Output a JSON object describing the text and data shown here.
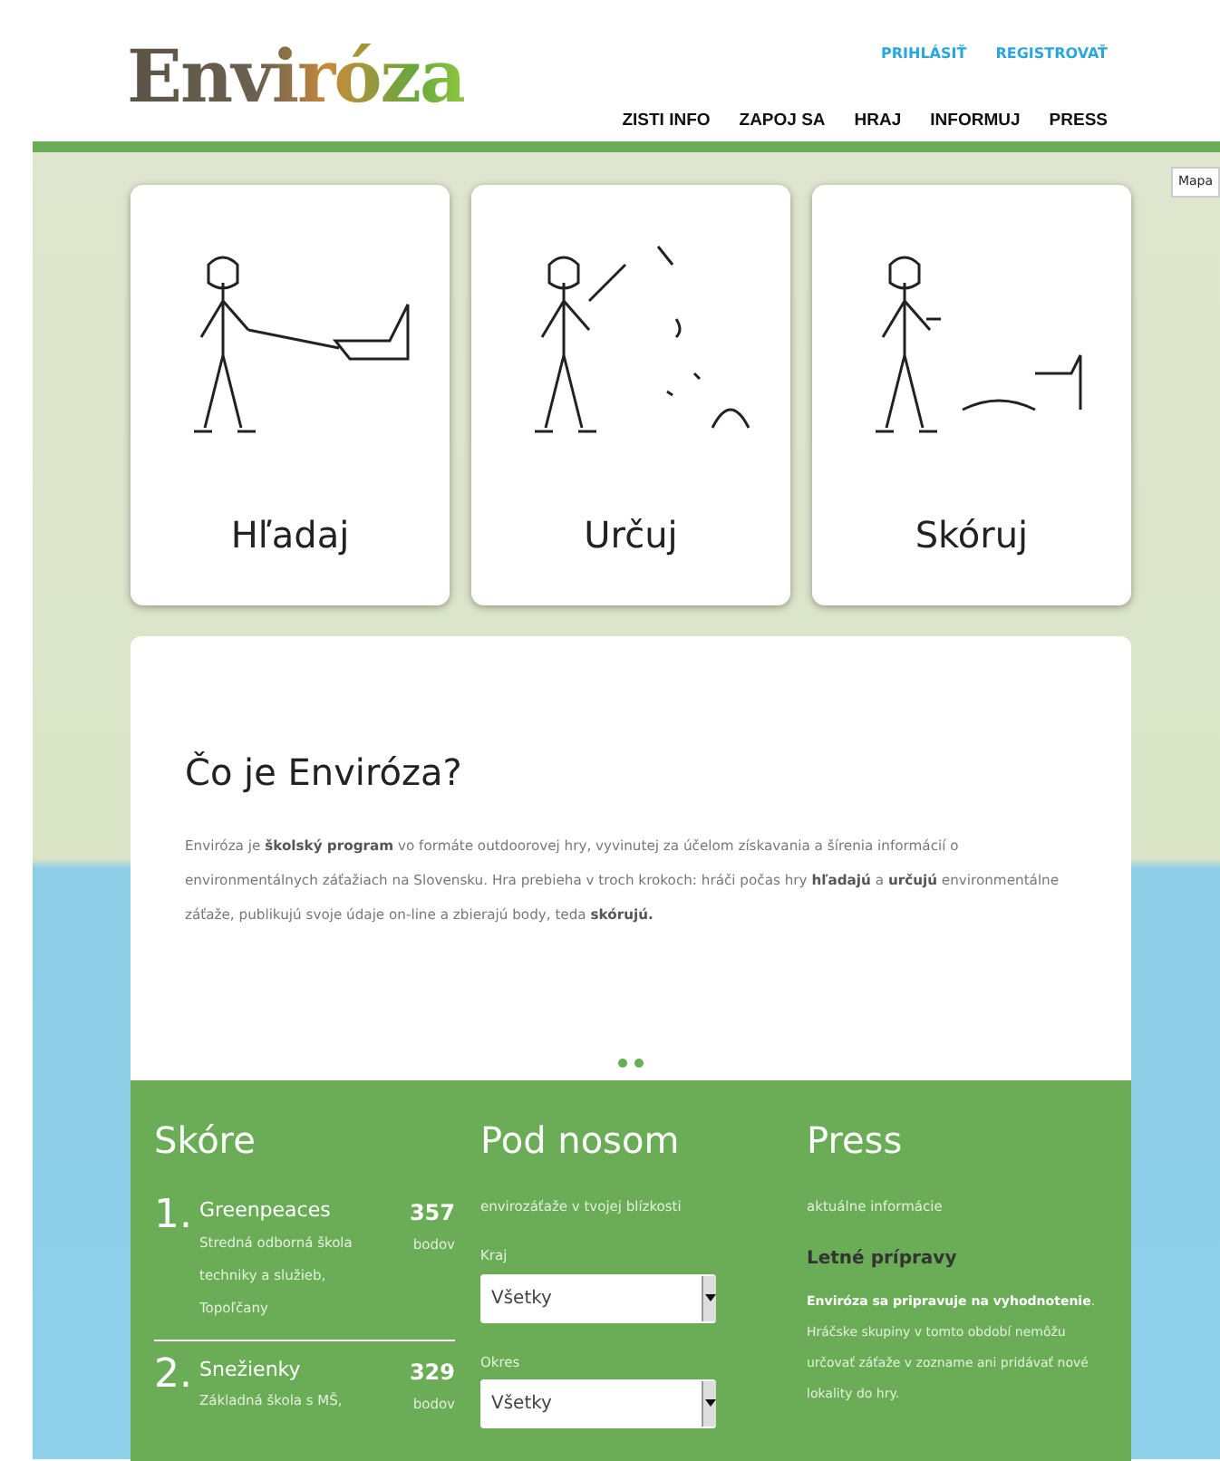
{
  "header": {
    "logo": "Enviróza",
    "account_links": [
      "PRIHLÁSIŤ",
      "REGISTROVAŤ"
    ],
    "nav": [
      "ZISTI INFO",
      "ZAPOJ SA",
      "HRAJ",
      "INFORMUJ",
      "PRESS"
    ]
  },
  "map": {
    "control": "Mapa"
  },
  "steps": [
    {
      "label": "Hľadaj",
      "kind": "search"
    },
    {
      "label": "Určuj",
      "kind": "identify"
    },
    {
      "label": "Skóruj",
      "kind": "score"
    }
  ],
  "intro": {
    "title": "Čo je Enviróza?",
    "text": "Enviróza je **školský program** vo formáte outdoorovej hry, vyvinutej za účelom získavania a šírenia informácií o environmentálnych záťažiach na Slovensku. Hra prebieha v troch krokoch: hráči počas hry **hľadajú** a **určujú** environmentálne záťaže, publikujú svoje údaje on-line a zbierajú body, teda **skórujú.**"
  },
  "score": {
    "title": "Skóre",
    "entries": [
      {
        "rank": "1.",
        "team": "Greenpeaces",
        "school": "Stredná odborná škola techniky a služieb, Topoľčany",
        "points": "357",
        "unit": "bodov"
      },
      {
        "rank": "2.",
        "team": "Snežienky",
        "school": "Základná škola s MŠ,",
        "points": "329",
        "unit": "bodov"
      }
    ]
  },
  "nearby": {
    "title": "Pod nosom",
    "subtitle": "envirozáťaže v tvojej blízkosti",
    "filters": [
      {
        "label": "Kraj",
        "value": "Všetky"
      },
      {
        "label": "Okres",
        "value": "Všetky"
      }
    ]
  },
  "press": {
    "title": "Press",
    "subtitle": "aktuálne informácie",
    "article_title": "Letné prípravy",
    "article_text": "**Enviróza sa pripravuje na vyhodnotenie**. Hráčske skupiny v tomto období nemôžu určovať záťaže v zozname ani pridávať nové lokality do hry."
  }
}
